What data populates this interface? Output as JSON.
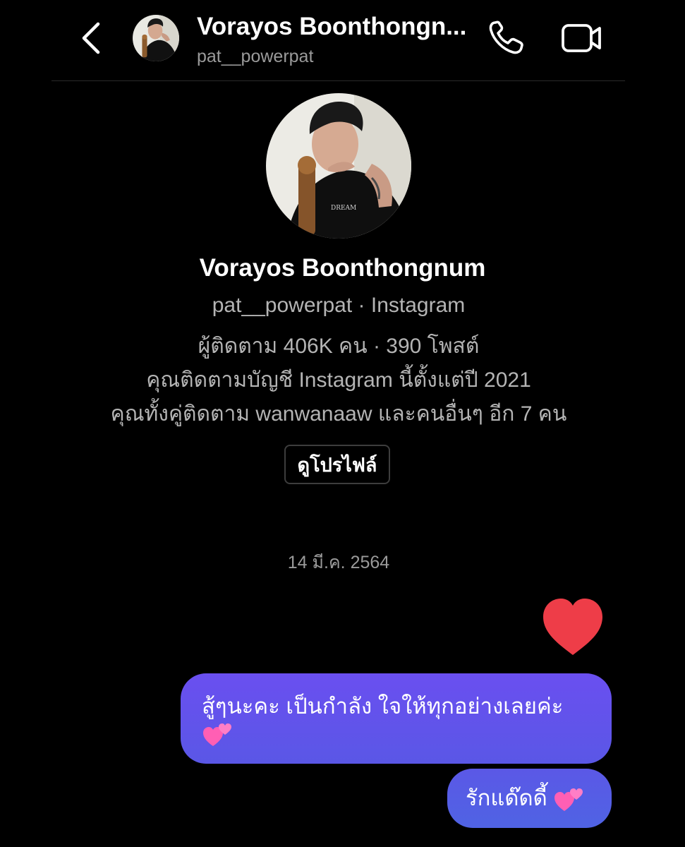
{
  "header": {
    "name": "Vorayos Boonthongn...",
    "username": "pat__powerpat"
  },
  "profile": {
    "name": "Vorayos Boonthongnum",
    "handle_line": "pat__powerpat · Instagram",
    "stats_line": "ผู้ติดตาม 406K คน · 390 โพสต์",
    "follow_since_line": "คุณติดตามบัญชี Instagram นี้ตั้งแต่ปี 2021",
    "mutual_line": "คุณทั้งคู่ติดตาม wanwanaaw และคนอื่นๆ อีก 7 คน",
    "view_profile_label": "ดูโปรไฟล์"
  },
  "chat": {
    "date_separator": "14 มี.ค. 2564",
    "messages": [
      {
        "type": "emoji",
        "icon": "red-heart-icon"
      },
      {
        "type": "text",
        "text": "สู้ๆนะคะ เป็นกำลัง ใจให้ทุกอย่างเลยค่ะ",
        "emoji": "two-hearts-icon"
      },
      {
        "type": "text",
        "text": "รักแด๊ดดี้",
        "emoji": "two-hearts-icon"
      }
    ]
  },
  "colors": {
    "background": "#000000",
    "bubble_top": "#6a4ff0",
    "bubble_bottom": "#4f63e4",
    "secondary_text": "#b4b4b4",
    "heart": "#ee3d48",
    "emoji_heart": "#ff5fb4"
  }
}
